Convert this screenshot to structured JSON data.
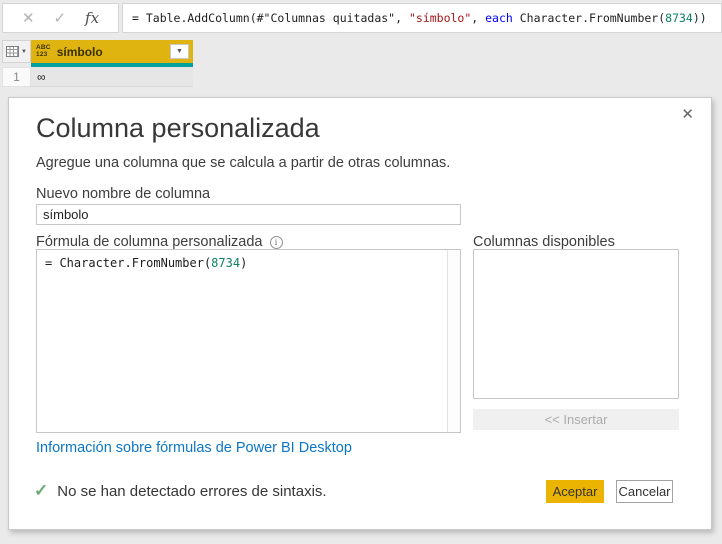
{
  "formula_bar": {
    "cancel_icon": "✕",
    "check_icon": "✓",
    "fx_icon": "fx",
    "parts": [
      {
        "text": "= Table.AddColumn(#\"Columnas quitadas\", ",
        "kind": "plain"
      },
      {
        "text": "\"símbolo\"",
        "kind": "string"
      },
      {
        "text": ", ",
        "kind": "plain"
      },
      {
        "text": "each",
        "kind": "keyword"
      },
      {
        "text": " Character.FromNumber(",
        "kind": "plain"
      },
      {
        "text": "8734",
        "kind": "number"
      },
      {
        "text": "))",
        "kind": "plain"
      }
    ]
  },
  "preview_table": {
    "column": {
      "type_icon_line1": "ABC",
      "type_icon_line2": "123",
      "name": "símbolo",
      "dropdown_icon": "▼"
    },
    "rows": [
      {
        "num": "1",
        "value": "∞"
      }
    ]
  },
  "dialog": {
    "close_icon": "✕",
    "title": "Columna personalizada",
    "subtitle": "Agregue una columna que se calcula a partir de otras columnas.",
    "name_label": "Nuevo nombre de columna",
    "name_value": "símbolo",
    "formula_label": "Fórmula de columna personalizada",
    "info_icon": "i",
    "formula_parts": [
      {
        "text": "= Character.FromNumber(",
        "kind": "plain"
      },
      {
        "text": "8734",
        "kind": "number"
      },
      {
        "text": ")",
        "kind": "plain"
      }
    ],
    "columns_label": "Columnas disponibles",
    "insert_button": "<< Insertar",
    "link": "Información sobre fórmulas de Power BI Desktop",
    "status_icon": "✓",
    "status_text": "No se han detectado errores de sintaxis.",
    "accept_button": "Aceptar",
    "cancel_button": "Cancelar"
  },
  "colors": {
    "column_header_yellow": "#e0b410",
    "selected_column_teal": "#00a19c",
    "accept_button_yellow": "#eab400",
    "link_blue": "#0b76c9",
    "token_string_red": "#a31515",
    "token_keyword_blue": "#0000ff",
    "token_number_teal": "#0e8165",
    "syntax_check_green": "#6ea873"
  }
}
